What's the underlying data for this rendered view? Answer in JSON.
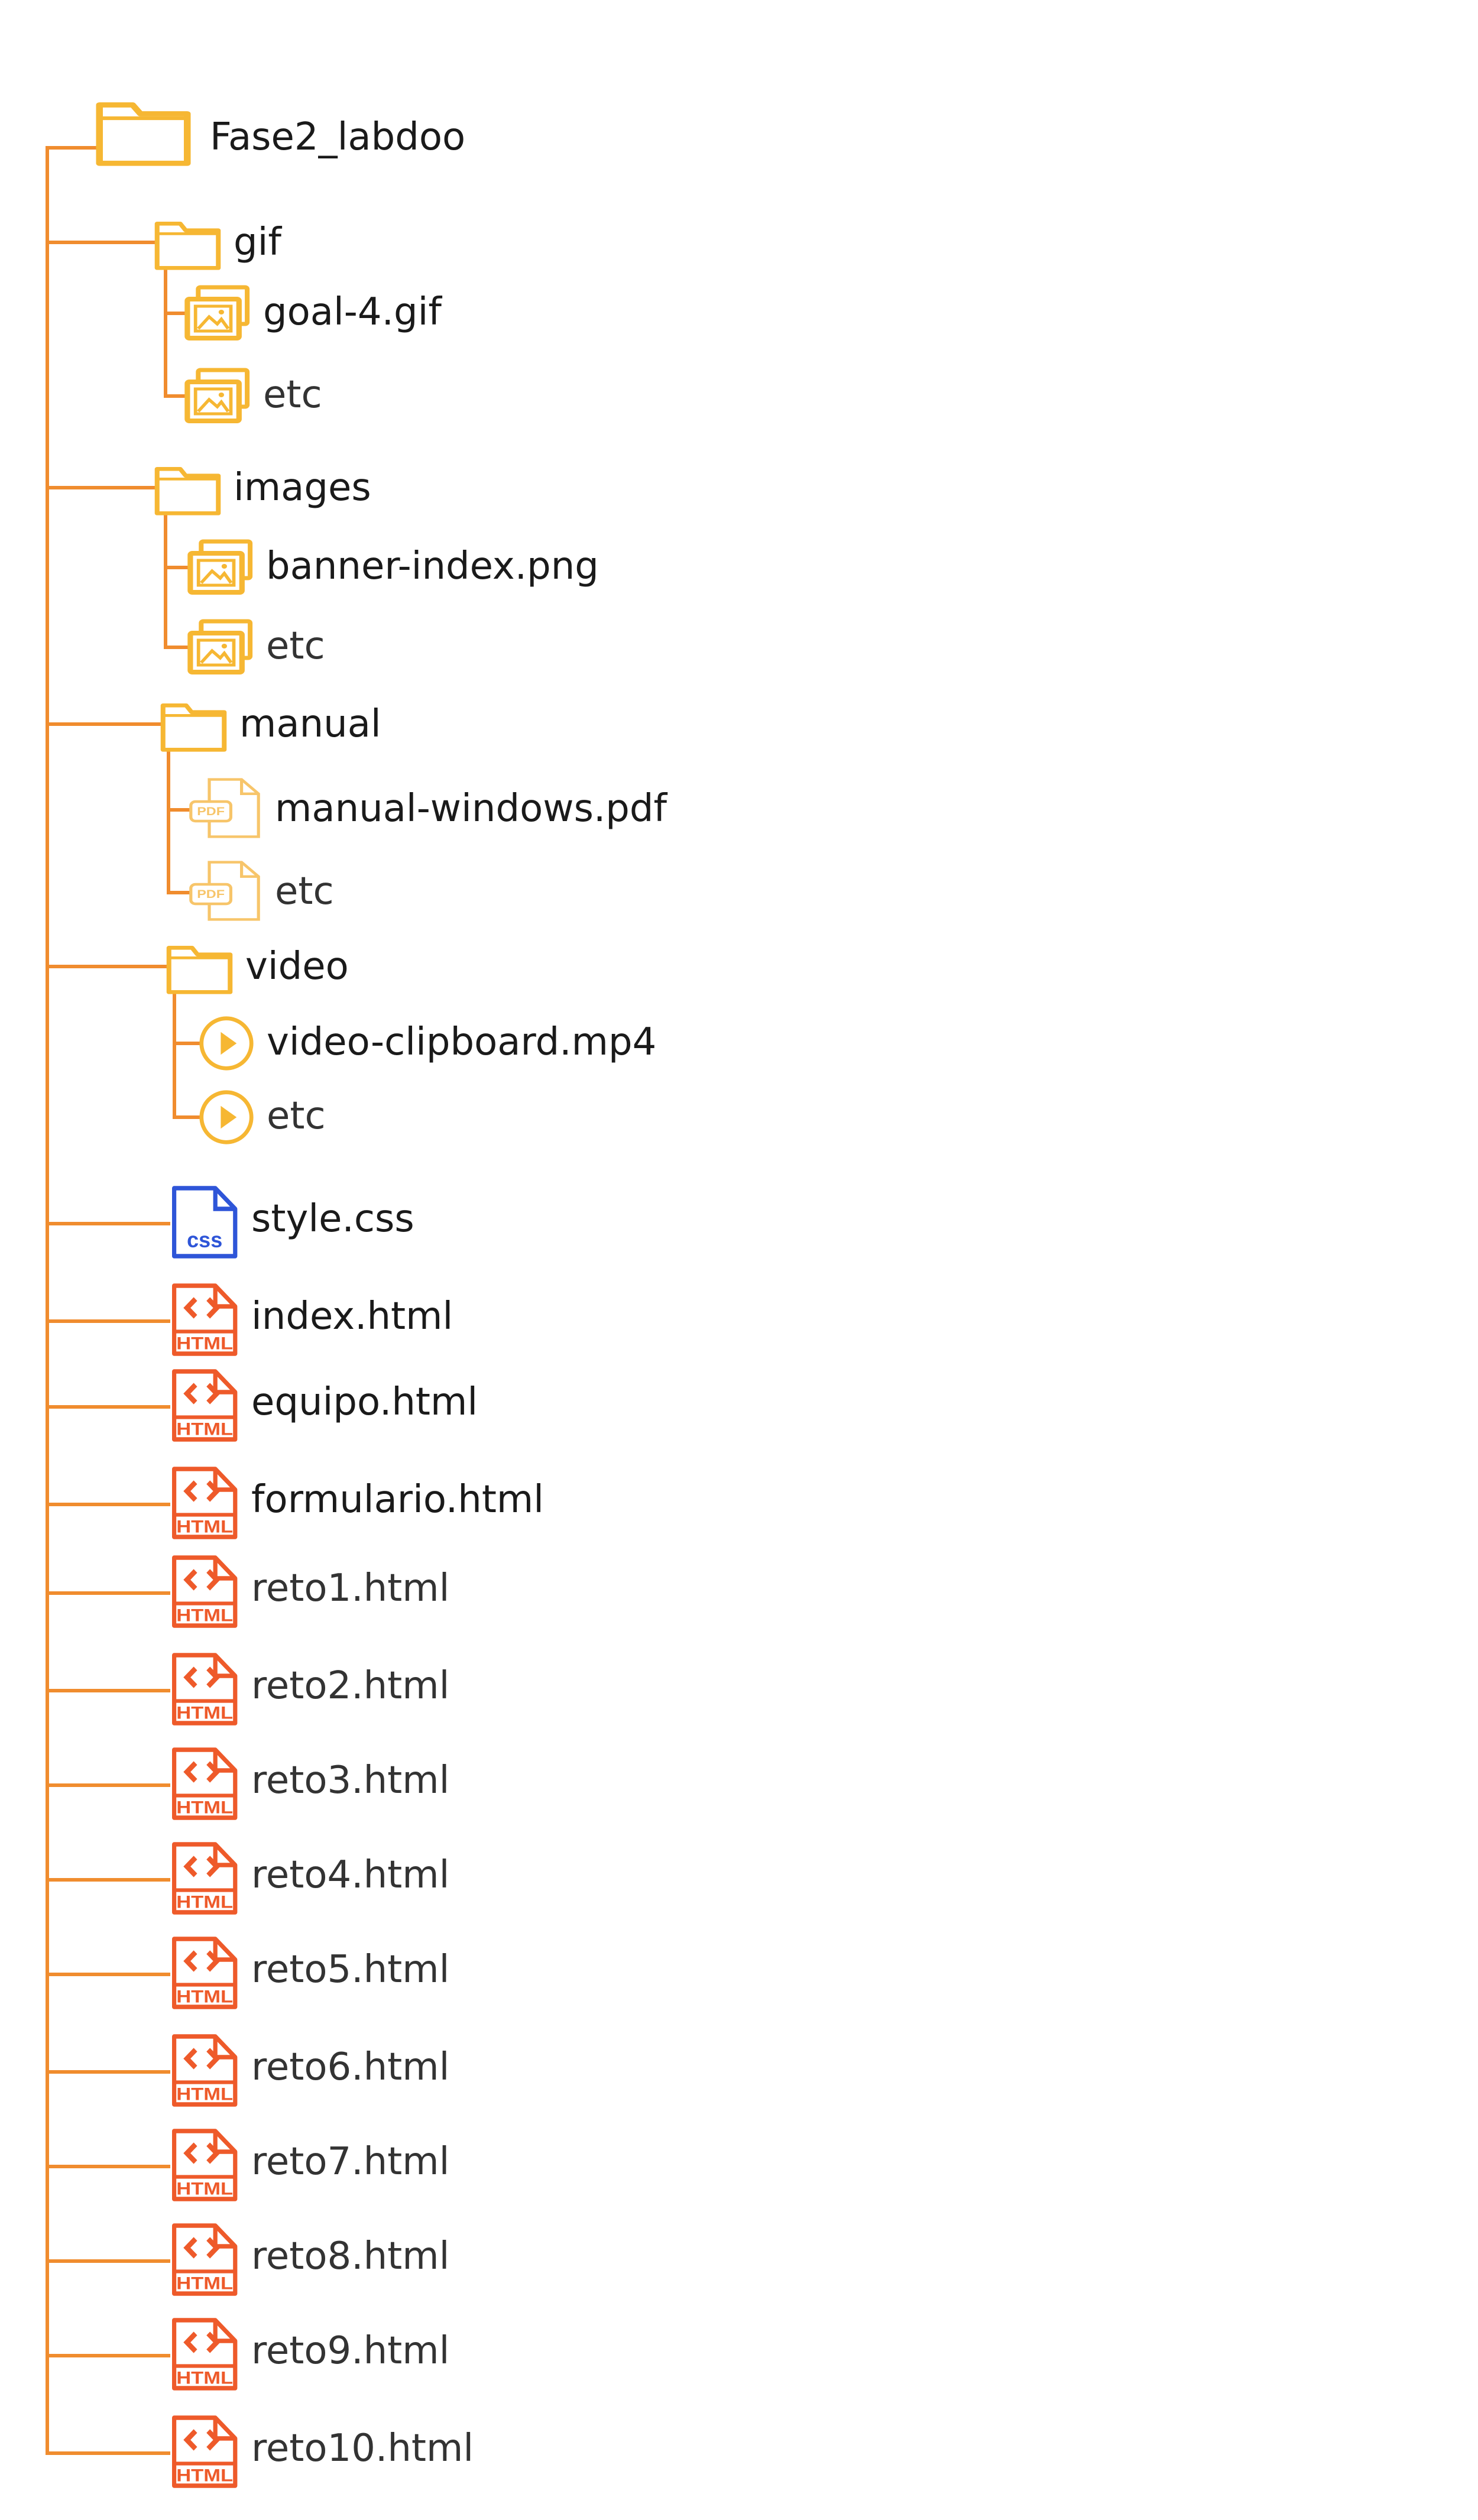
{
  "colors": {
    "line": "#f08c2e",
    "folder": "#f6b733",
    "image_icon": "#f6b733",
    "pdf_icon": "#f7c56a",
    "video_icon": "#f6b733",
    "css_icon": "#2e55d8",
    "html_icon": "#ee5a2a",
    "text": "#1a1a1a"
  },
  "root": {
    "name": "Fase2_labdoo",
    "icon": "folder-icon"
  },
  "items": [
    {
      "kind": "folder",
      "name": "gif",
      "icon": "folder-icon",
      "children": [
        {
          "name": "goal-4.gif",
          "icon": "image-file-icon"
        },
        {
          "name": "etc",
          "icon": "image-file-icon"
        }
      ]
    },
    {
      "kind": "folder",
      "name": "images",
      "icon": "folder-icon",
      "children": [
        {
          "name": "banner-index.png",
          "icon": "image-file-icon"
        },
        {
          "name": "etc",
          "icon": "image-file-icon"
        }
      ]
    },
    {
      "kind": "folder",
      "name": "manual",
      "icon": "folder-icon",
      "children": [
        {
          "name": "manual-windows.pdf",
          "icon": "pdf-file-icon"
        },
        {
          "name": "etc",
          "icon": "pdf-file-icon"
        }
      ]
    },
    {
      "kind": "folder",
      "name": "video",
      "icon": "folder-icon",
      "children": [
        {
          "name": "video-clipboard.mp4",
          "icon": "video-file-icon"
        },
        {
          "name": "etc",
          "icon": "video-file-icon"
        }
      ]
    },
    {
      "kind": "file",
      "name": "style.css",
      "icon": "css-file-icon",
      "badge": "css"
    },
    {
      "kind": "file",
      "name": "index.html",
      "icon": "html-file-icon",
      "badge": "HTML"
    },
    {
      "kind": "file",
      "name": "equipo.html",
      "icon": "html-file-icon",
      "badge": "HTML"
    },
    {
      "kind": "file",
      "name": "formulario.html",
      "icon": "html-file-icon",
      "badge": "HTML"
    },
    {
      "kind": "file",
      "name": "reto1.html",
      "icon": "html-file-icon",
      "badge": "HTML"
    },
    {
      "kind": "file",
      "name": "reto2.html",
      "icon": "html-file-icon",
      "badge": "HTML"
    },
    {
      "kind": "file",
      "name": "reto3.html",
      "icon": "html-file-icon",
      "badge": "HTML"
    },
    {
      "kind": "file",
      "name": "reto4.html",
      "icon": "html-file-icon",
      "badge": "HTML"
    },
    {
      "kind": "file",
      "name": "reto5.html",
      "icon": "html-file-icon",
      "badge": "HTML"
    },
    {
      "kind": "file",
      "name": "reto6.html",
      "icon": "html-file-icon",
      "badge": "HTML"
    },
    {
      "kind": "file",
      "name": "reto7.html",
      "icon": "html-file-icon",
      "badge": "HTML"
    },
    {
      "kind": "file",
      "name": "reto8.html",
      "icon": "html-file-icon",
      "badge": "HTML"
    },
    {
      "kind": "file",
      "name": "reto9.html",
      "icon": "html-file-icon",
      "badge": "HTML"
    },
    {
      "kind": "file",
      "name": "reto10.html",
      "icon": "html-file-icon",
      "badge": "HTML"
    }
  ]
}
